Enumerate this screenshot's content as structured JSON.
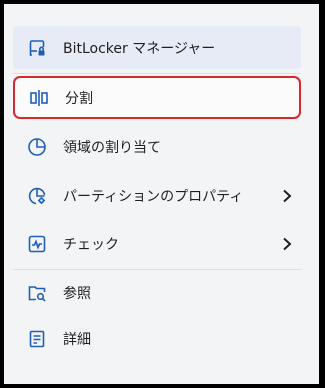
{
  "menu": {
    "items": [
      {
        "label": "BitLocker マネージャー",
        "icon": "bitlocker-drive-icon"
      },
      {
        "label": "分割",
        "icon": "split-icon"
      },
      {
        "label": "領域の割り当て",
        "icon": "allocate-space-icon"
      },
      {
        "label": "パーティションのプロパティ",
        "icon": "partition-properties-icon"
      },
      {
        "label": "チェック",
        "icon": "check-icon"
      },
      {
        "label": "参照",
        "icon": "browse-folder-icon"
      },
      {
        "label": "詳細",
        "icon": "details-icon"
      }
    ]
  },
  "colors": {
    "accent": "#1f5fb8",
    "highlight_border": "#d9272e",
    "active_bg": "#e6ebf5",
    "panel_bg": "#f3f4f6"
  }
}
